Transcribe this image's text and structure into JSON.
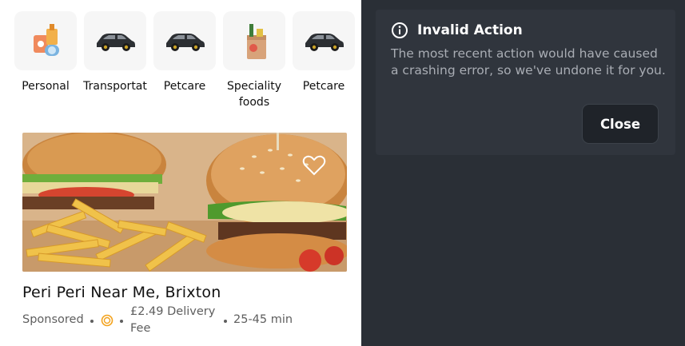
{
  "categories": [
    {
      "label": "Personal",
      "icon": "personal-care-icon"
    },
    {
      "label": "Transportat",
      "icon": "car-icon"
    },
    {
      "label": "Petcare",
      "icon": "car-icon"
    },
    {
      "label": "Speciality foods",
      "icon": "grocery-bag-icon"
    },
    {
      "label": "Petcare",
      "icon": "car-icon"
    }
  ],
  "restaurant": {
    "name": "Peri Peri Near Me, Brixton",
    "sponsored": "Sponsored",
    "delivery_fee": "£2.49 Delivery Fee",
    "eta": "25-45 min",
    "image": "burger-and-fries-photo"
  },
  "dialog": {
    "title": "Invalid Action",
    "message": "The most recent action would have caused a crashing error, so we've undone it for you.",
    "close_label": "Close"
  },
  "colors": {
    "dialog_bg": "#30353d",
    "backdrop": "#2a2f36",
    "close_button_bg": "#1f2329",
    "offer_icon": "#f3a21c"
  }
}
